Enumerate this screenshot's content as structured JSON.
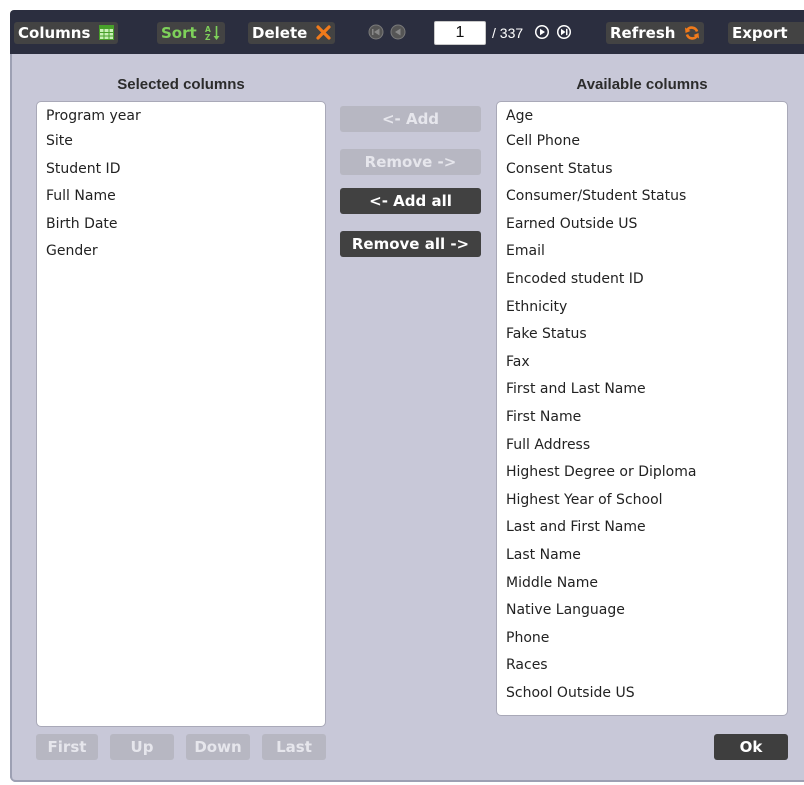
{
  "toolbar": {
    "columns_label": "Columns",
    "sort_label": "Sort",
    "delete_label": "Delete",
    "page_value": "1",
    "page_total": "/ 337",
    "refresh_label": "Refresh",
    "export_label": "Export"
  },
  "selected": {
    "title": "Selected columns",
    "items": [
      "Program year",
      "Site",
      "Student ID",
      "Full Name",
      "Birth Date",
      "Gender"
    ]
  },
  "available": {
    "title": "Available columns",
    "items": [
      "Age",
      "Cell Phone",
      "Consent Status",
      "Consumer/Student Status",
      "Earned Outside US",
      "Email",
      "Encoded student ID",
      "Ethnicity",
      "Fake Status",
      "Fax",
      "First and Last Name",
      "First Name",
      "Full Address",
      "Highest Degree or Diploma",
      "Highest Year of School",
      "Last and First Name",
      "Last Name",
      "Middle Name",
      "Native Language",
      "Phone",
      "Races",
      "School Outside US"
    ]
  },
  "actions": {
    "add": "<- Add",
    "remove": "Remove ->",
    "add_all": "<- Add all",
    "remove_all": "Remove all ->"
  },
  "order": {
    "first": "First",
    "up": "Up",
    "down": "Down",
    "last": "Last"
  },
  "ok_label": "Ok",
  "colors": {
    "toolbar_bg": "#2b2e3f",
    "panel_bg": "#c8c8d8",
    "button_bg": "#434343",
    "disabled_bg": "#b7b7c2",
    "accent_green": "#7ed15a",
    "delete_icon": "#f07a1b",
    "refresh_icon": "#f07a1b"
  },
  "icons": [
    "table-icon",
    "sort-az-icon",
    "delete-x-icon",
    "first-page-icon",
    "prev-page-icon",
    "next-page-icon",
    "last-page-icon",
    "refresh-icon"
  ]
}
